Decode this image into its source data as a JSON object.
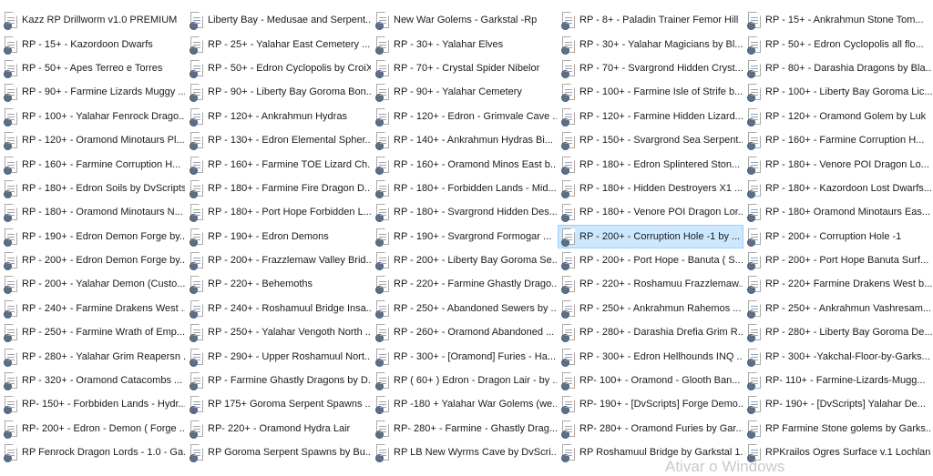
{
  "view": {
    "selected_index": 48,
    "watermark": "Ativar o Windows"
  },
  "files": [
    "Kazz RP Drillworm v1.0 PREMIUM",
    "Liberty Bay - Medusae and Serpent...",
    "New War Golems - Garkstal -Rp",
    "RP - 8+ - Paladin Trainer Femor Hill",
    "RP - 15+ - Ankrahmun Stone Tom...",
    "RP - 15+ - Kazordoon Dwarfs",
    "RP - 25+ - Yalahar East Cemetery ...",
    "RP - 30+ - Yalahar Elves",
    "RP - 30+ - Yalahar Magicians by Bl...",
    "RP - 50+ - Edron Cyclopolis all flo...",
    "RP - 50+ - Apes Terreo e Torres",
    "RP - 50+ - Edron Cyclopolis by CroiX",
    "RP - 70+ - Crystal Spider Nibelor",
    "RP - 70+ - Svargrond Hidden Cryst...",
    "RP - 80+ - Darashia Dragons by Bla...",
    "RP - 90+ - Farmine Lizards Muggy ...",
    "RP - 90+ - Liberty Bay Goroma Bon...",
    "RP - 90+ - Yalahar Cemetery",
    "RP - 100+ - Farmine Isle of Strife b...",
    "RP - 100+ - Liberty Bay Goroma Lic...",
    "RP - 100+ - Yalahar Fenrock Drago...",
    "RP - 120+ - Ankrahmun Hydras",
    "RP - 120+ - Edron - Grimvale Cave ...",
    "RP - 120+ - Farmine Hidden Lizard...",
    "RP - 120+ - Oramond Golem by Luk",
    "RP - 120+ - Oramond Minotaurs Pl...",
    "RP - 130+ - Edron Elemental Spher...",
    "RP - 140+ - Ankrahmun Hydras Bi...",
    "RP - 150+ - Svargrond Sea Serpent...",
    "RP - 160+ - Farmine Corruption H...",
    "RP - 160+ - Farmine Corruption H...",
    "RP - 160+ - Farmine TOE Lizard Ch...",
    "RP - 160+ - Oramond Minos East b...",
    "RP - 180+ -  Edron Splintered Ston...",
    "RP - 180+ -  Venore POI Dragon Lo...",
    "RP - 180+ - Edron Soils by DvScripts",
    "RP - 180+ - Farmine Fire Dragon D...",
    "RP - 180+ - Forbidden Lands - Mid...",
    "RP - 180+ - Hidden Destroyers X1 ...",
    "RP - 180+ - Kazordoon Lost Dwarfs...",
    "RP - 180+ - Oramond Minotaurs N...",
    "RP - 180+ - Port Hope Forbidden L...",
    "RP - 180+ - Svargrond  Hidden Des...",
    "RP - 180+ - Venore POI Dragon Lor...",
    "RP - 180+ Oramond Minotaurs Eas...",
    "RP - 190+ - Edron Demon Forge by...",
    "RP - 190+ - Edron Demons",
    "RP - 190+ - Svargrond Formogar ...",
    "RP - 200+ - Corruption Hole -1 by ...",
    "RP - 200+ - Corruption Hole -1",
    "RP - 200+ - Edron Demon Forge by...",
    "RP - 200+ - Frazzlemaw Valley Brid...",
    "RP - 200+ - Liberty Bay Goroma Se...",
    "RP - 200+ - Port Hope - Banuta ( S...",
    "RP - 200+ - Port Hope Banuta Surf...",
    "RP - 200+ - Yalahar Demon (Custo...",
    "RP - 220+ - Behemoths",
    "RP - 220+ - Farmine Ghastly Drago...",
    "RP - 220+ - Roshamuu Frazzlemaw...",
    "RP - 220+ Farmine Drakens West b...",
    "RP - 240+ - Farmine Drakens West ...",
    "RP - 240+ - Roshamuul Bridge Insa...",
    "RP - 250+ - Abandoned Sewers by ...",
    "RP - 250+ - Ankrahmun Rahemos ...",
    "RP - 250+ - Ankrahmun Vashresam...",
    "RP - 250+ - Farmine Wrath of Emp...",
    "RP - 250+ - Yalahar Vengoth North ...",
    "RP - 260+ - Oramond Abandoned ...",
    "RP - 280+ - Darashia Drefia Grim R...",
    "RP - 280+ - Liberty Bay Goroma De...",
    "RP - 280+ - Yalahar Grim Reapersn ...",
    "RP - 290+ - Upper Roshamuul Nort...",
    "RP - 300+ - [Oramond] Furies  - Ha...",
    "RP - 300+ - Edron Hellhounds INQ ...",
    "RP - 300+ -Yakchal-Floor-by-Garks...",
    "RP - 320+ - Oramond Catacombs ...",
    "RP - Farmine Ghastly Dragons by D...",
    "RP ( 60+ ) Edron - Dragon Lair - by ...",
    "RP- 100+ - Oramond - Glooth Ban...",
    "RP- 110+ - Farmine-Lizards-Mugg...",
    "RP- 150+ - Forbbiden Lands - Hydr...",
    "RP 175+ Goroma Serpent Spawns ...",
    "RP -180 + Yalahar War Golems (we...",
    "RP- 190+ - [DvScripts] Forge Demo...",
    "RP- 190+ - [DvScripts] Yalahar De...",
    "RP- 200+ - Edron - Demon ( Forge ...",
    "RP- 220+ - Oramond Hydra Lair",
    "RP- 280+ - Farmine - Ghastly Drag...",
    "RP- 280+ - Oramond Furies by Gar...",
    "RP Farmine Stone golems by Garks...",
    "RP Fenrock Dragon Lords - 1.0 - Ga...",
    "RP Goroma Serpent Spawns by Bu...",
    "RP LB New Wyrms Cave by DvScri...",
    "RP Roshamuul Bridge by Garkstal 1...",
    "RPKrailos Ogres Surface v.1 Lochlan"
  ]
}
